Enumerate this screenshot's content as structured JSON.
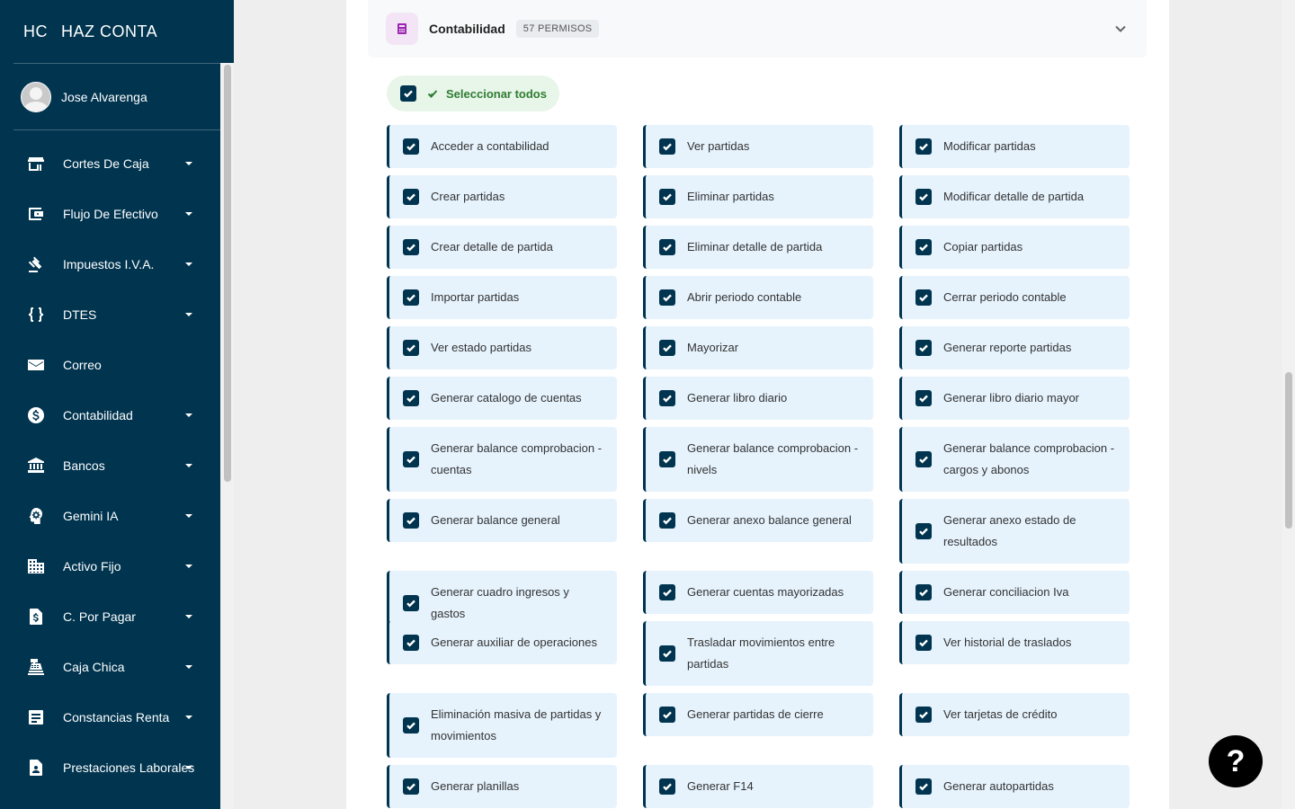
{
  "app": {
    "logo_mini": "HC",
    "logo_name": "HAZ CONTA"
  },
  "user": {
    "name": "Jose Alvarenga"
  },
  "sidebar": {
    "items": [
      {
        "label": "Cortes De Caja",
        "icon": "store-icon",
        "caret": true
      },
      {
        "label": "Flujo De Efectivo",
        "icon": "wallet-icon",
        "caret": true
      },
      {
        "label": "Impuestos I.V.A.",
        "icon": "gavel-icon",
        "caret": true
      },
      {
        "label": "DTES",
        "icon": "code-braces-icon",
        "caret": true
      },
      {
        "label": "Correo",
        "icon": "mail-icon",
        "caret": false
      },
      {
        "label": "Contabilidad",
        "icon": "dollar-circle-icon",
        "caret": true
      },
      {
        "label": "Bancos",
        "icon": "bank-icon",
        "caret": true
      },
      {
        "label": "Gemini IA",
        "icon": "brain-head-icon",
        "caret": true
      },
      {
        "label": "Activo Fijo",
        "icon": "building-icon",
        "caret": true
      },
      {
        "label": "C. Por Pagar",
        "icon": "invoice-dollar-icon",
        "caret": true
      },
      {
        "label": "Caja Chica",
        "icon": "cash-register-icon",
        "caret": true
      },
      {
        "label": "Constancias Renta",
        "icon": "document-icon",
        "caret": true
      },
      {
        "label": "Prestaciones Laborales",
        "icon": "badge-person-icon",
        "caret": true
      }
    ]
  },
  "section": {
    "title": "Contabilidad",
    "badge": "57 PERMISOS",
    "select_all": "Seleccionar todos"
  },
  "permissions": [
    [
      "Acceder a contabilidad",
      "Ver partidas",
      "Modificar partidas"
    ],
    [
      "Crear partidas",
      "Eliminar partidas",
      "Modificar detalle de partida"
    ],
    [
      "Crear detalle de partida",
      "Eliminar detalle de partida",
      "Copiar partidas"
    ],
    [
      "Importar partidas",
      "Abrir periodo contable",
      "Cerrar periodo contable"
    ],
    [
      "Ver estado partidas",
      "Mayorizar",
      "Generar reporte partidas"
    ],
    [
      "Generar catalogo de cuentas",
      "Generar libro diario",
      "Generar libro diario mayor"
    ],
    [
      "Generar balance comprobacion - cuentas",
      "Generar balance comprobacion - nivels",
      "Generar balance comprobacion - cargos y abonos"
    ],
    [
      "Generar balance general",
      "Generar anexo balance general",
      "Generar anexo estado de resultados"
    ],
    [
      "Generar cuadro ingresos y gastos",
      "Generar cuentas mayorizadas",
      "Generar conciliacion Iva"
    ],
    [
      "Generar auxiliar de operaciones",
      "Trasladar movimientos entre partidas",
      "Ver historial de traslados"
    ],
    [
      "Eliminación masiva de partidas y movimientos",
      "Generar partidas de cierre",
      "Ver tarjetas de crédito"
    ],
    [
      "Generar planillas",
      "Generar F14",
      "Generar autopartidas"
    ]
  ],
  "help": {
    "label": "?"
  },
  "colors": {
    "sidebar": "#00344f",
    "perm_bg": "#e6f3fd",
    "select_all_bg": "#e8f5e9",
    "accent_green": "#2e7d32",
    "section_icon": "#9c27b0"
  }
}
